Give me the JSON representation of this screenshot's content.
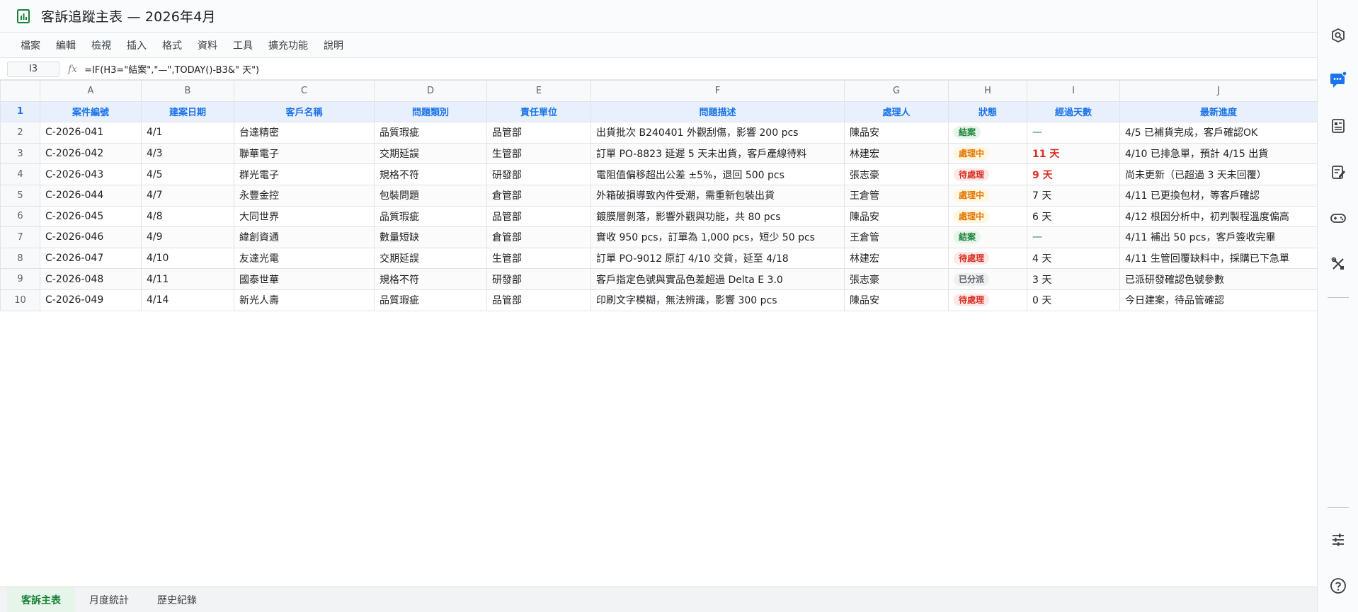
{
  "document": {
    "title": "客訴追蹤主表 — 2026年4月"
  },
  "menu": {
    "items": [
      "檔案",
      "編輯",
      "檢視",
      "插入",
      "格式",
      "資料",
      "工具",
      "擴充功能",
      "說明"
    ]
  },
  "formula_bar": {
    "cell_ref": "I3",
    "fx_label": "fx",
    "formula": "=IF(H3=\"結案\",\"—\",TODAY()-B3&\" 天\")"
  },
  "grid": {
    "column_letters": [
      "A",
      "B",
      "C",
      "D",
      "E",
      "F",
      "G",
      "H",
      "I",
      "J"
    ],
    "header_row_number": "1",
    "headers": [
      "案件編號",
      "建案日期",
      "客戶名稱",
      "問題類別",
      "責任單位",
      "問題描述",
      "處理人",
      "狀態",
      "經過天數",
      "最新進度"
    ],
    "rows": [
      {
        "row": "2",
        "id": "C-2026-041",
        "date": "4/1",
        "customer": "台達精密",
        "category": "品質瑕疵",
        "dept": "品管部",
        "desc": "出貨批次 B240401 外觀刮傷，影響 200 pcs",
        "handler": "陳品安",
        "status": "結案",
        "status_type": "closed",
        "days": "—",
        "days_type": "dash",
        "progress": "4/5 已補貨完成，客戶確認OK"
      },
      {
        "row": "3",
        "id": "C-2026-042",
        "date": "4/3",
        "customer": "聯華電子",
        "category": "交期延誤",
        "dept": "生管部",
        "desc": "訂單 PO-8823 延遲 5 天未出貨，客戶產線待料",
        "handler": "林建宏",
        "status": "處理中",
        "status_type": "processing",
        "days": "11 天",
        "days_type": "alert",
        "progress": "4/10 已排急單，預計 4/15 出貨"
      },
      {
        "row": "4",
        "id": "C-2026-043",
        "date": "4/5",
        "customer": "群光電子",
        "category": "規格不符",
        "dept": "研發部",
        "desc": "電阻值偏移超出公差 ±5%，退回 500 pcs",
        "handler": "張志豪",
        "status": "待處理",
        "status_type": "pending",
        "days": "9 天",
        "days_type": "alert",
        "progress": "尚未更新（已超過 3 天未回覆）"
      },
      {
        "row": "5",
        "id": "C-2026-044",
        "date": "4/7",
        "customer": "永豐金控",
        "category": "包裝問題",
        "dept": "倉管部",
        "desc": "外箱破損導致內件受潮，需重新包裝出貨",
        "handler": "王倉管",
        "status": "處理中",
        "status_type": "processing",
        "days": "7 天",
        "days_type": "normal",
        "progress": "4/11 已更換包材，等客戶確認"
      },
      {
        "row": "6",
        "id": "C-2026-045",
        "date": "4/8",
        "customer": "大同世界",
        "category": "品質瑕疵",
        "dept": "品管部",
        "desc": "鍍膜層剝落，影響外觀與功能，共 80 pcs",
        "handler": "陳品安",
        "status": "處理中",
        "status_type": "processing",
        "days": "6 天",
        "days_type": "normal",
        "progress": "4/12 根因分析中，初判製程溫度偏高"
      },
      {
        "row": "7",
        "id": "C-2026-046",
        "date": "4/9",
        "customer": "緯創資通",
        "category": "數量短缺",
        "dept": "倉管部",
        "desc": "實收 950 pcs，訂單為 1,000 pcs，短少 50 pcs",
        "handler": "王倉管",
        "status": "結案",
        "status_type": "closed",
        "days": "—",
        "days_type": "dash",
        "progress": "4/11 補出 50 pcs，客戶簽收完畢"
      },
      {
        "row": "8",
        "id": "C-2026-047",
        "date": "4/10",
        "customer": "友達光電",
        "category": "交期延誤",
        "dept": "生管部",
        "desc": "訂單 PO-9012 原訂 4/10 交貨，延至 4/18",
        "handler": "林建宏",
        "status": "待處理",
        "status_type": "pending",
        "days": "4 天",
        "days_type": "normal",
        "progress": "4/11 生管回覆缺料中，採購已下急單"
      },
      {
        "row": "9",
        "id": "C-2026-048",
        "date": "4/11",
        "customer": "國泰世華",
        "category": "規格不符",
        "dept": "研發部",
        "desc": "客戶指定色號與實品色差超過 Delta E 3.0",
        "handler": "張志豪",
        "status": "已分派",
        "status_type": "assigned",
        "days": "3 天",
        "days_type": "normal",
        "progress": "已派研發確認色號參數"
      },
      {
        "row": "10",
        "id": "C-2026-049",
        "date": "4/14",
        "customer": "新光人壽",
        "category": "品質瑕疵",
        "dept": "品管部",
        "desc": "印刷文字模糊，無法辨識，影響 300 pcs",
        "handler": "陳品安",
        "status": "待處理",
        "status_type": "pending",
        "days": "0 天",
        "days_type": "normal",
        "progress": "今日建案，待品管確認"
      }
    ]
  },
  "sheet_tabs": [
    {
      "label": "客訴主表",
      "active": true
    },
    {
      "label": "月度統計",
      "active": false
    },
    {
      "label": "歷史紀錄",
      "active": false
    }
  ],
  "side_panel": {
    "icons": [
      "search-history-icon",
      "chat-notification-icon",
      "contacts-card-icon",
      "edit-notes-icon",
      "gamepad-icon",
      "tools-icon",
      "tune-icon",
      "help-icon"
    ]
  },
  "colors": {
    "brand_green": "#188038",
    "header_blue": "#1a73e8",
    "alert_red": "#d93025",
    "processing_orange": "#e37400"
  }
}
